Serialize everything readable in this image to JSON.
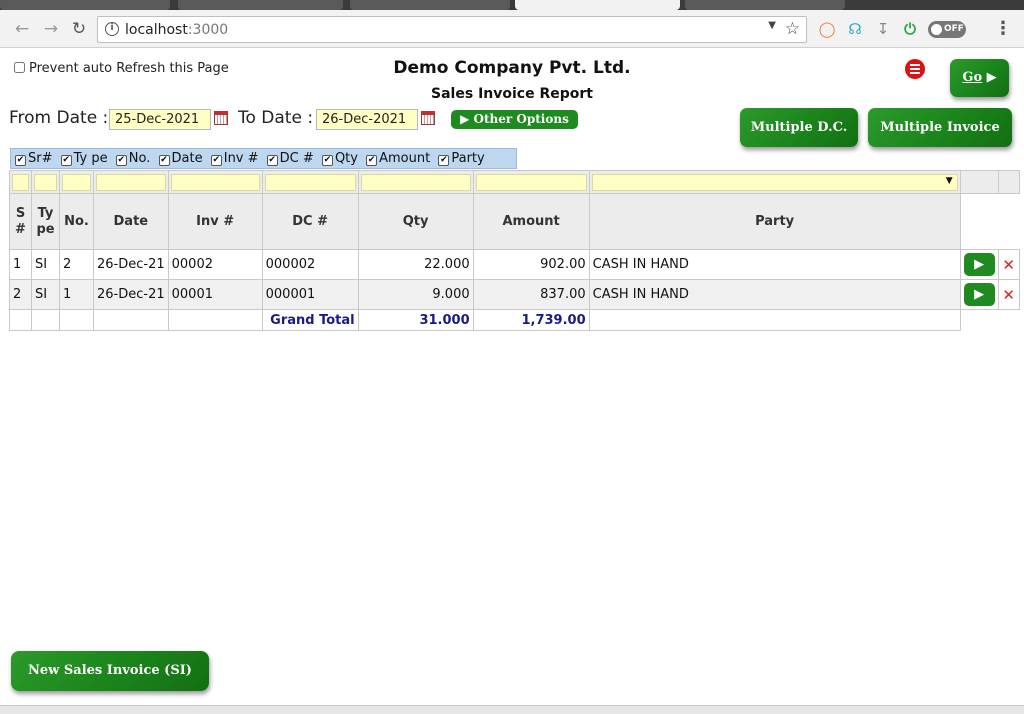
{
  "browser": {
    "url_host": "localhost",
    "url_port": ":3000",
    "toggle_label": "OFF"
  },
  "page": {
    "prevent_refresh_label": "Prevent auto Refresh this Page",
    "company_name": "Demo Company Pvt. Ltd.",
    "report_title": "Sales Invoice Report",
    "go_label": "Go",
    "from_label": "From Date :",
    "from_value": "25-Dec-2021",
    "to_label": "To Date :",
    "to_value": "26-Dec-2021",
    "other_options_label": "▶ Other Options",
    "multiple_dc_label": "Multiple D.C.",
    "multiple_invoice_label": "Multiple Invoice",
    "new_invoice_label": "New Sales Invoice (SI)"
  },
  "column_toggles": [
    "Sr#",
    "Ty pe",
    "No.",
    "Date",
    "Inv #",
    "DC #",
    "Qty",
    "Amount",
    "Party"
  ],
  "table": {
    "headers": {
      "sr": "S #",
      "type": "Ty pe",
      "no": "No.",
      "date": "Date",
      "inv": "Inv #",
      "dc": "DC #",
      "qty": "Qty",
      "amount": "Amount",
      "party": "Party"
    },
    "rows": [
      {
        "sr": "1",
        "type": "SI",
        "no": "2",
        "date": "26-Dec-21",
        "inv": "00002",
        "dc": "000002",
        "qty": "22.000",
        "amount": "902.00",
        "party": "CASH IN HAND"
      },
      {
        "sr": "2",
        "type": "SI",
        "no": "1",
        "date": "26-Dec-21",
        "inv": "00001",
        "dc": "000001",
        "qty": "9.000",
        "amount": "837.00",
        "party": "CASH IN HAND"
      }
    ],
    "grand_total_label": "Grand Total",
    "total_qty": "31.000",
    "total_amount": "1,739.00"
  },
  "colors": {
    "button_green": "#1f8a1f",
    "filter_yellow": "#ffffc4",
    "toggle_bar_blue": "#bed7f0",
    "total_navy": "#1a1a8a",
    "alert_red": "#e01010"
  }
}
